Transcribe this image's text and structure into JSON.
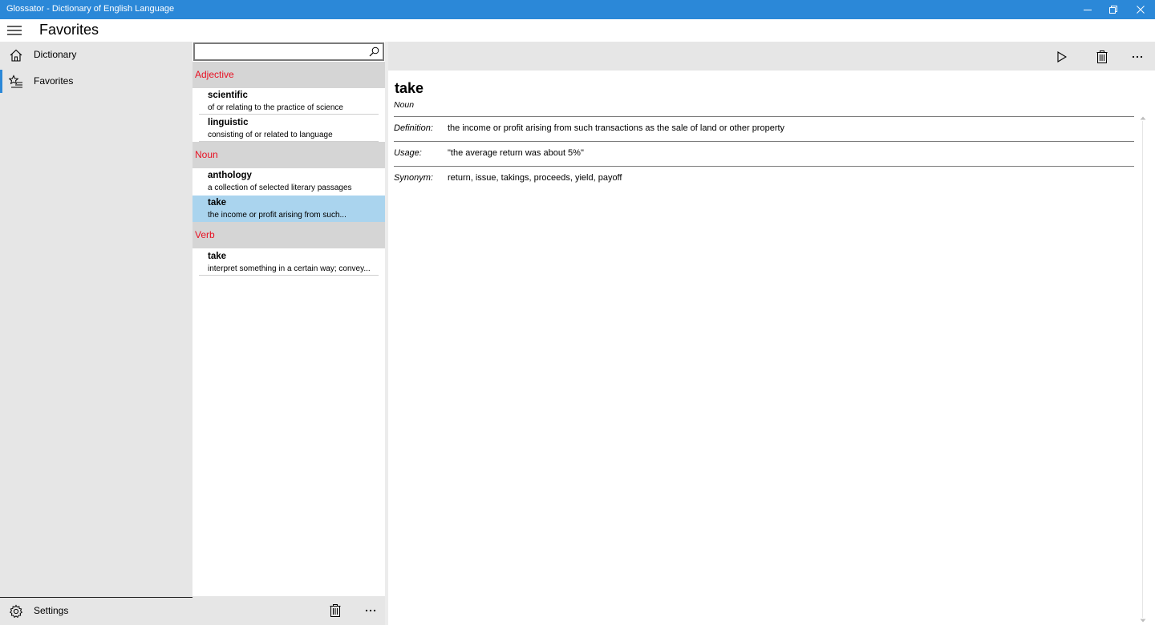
{
  "window": {
    "title": "Glossator - Dictionary of English Language"
  },
  "header": {
    "page_title": "Favorites"
  },
  "nav": {
    "items": [
      {
        "label": "Dictionary",
        "icon": "home-icon"
      },
      {
        "label": "Favorites",
        "icon": "favorites-icon",
        "selected": true
      }
    ],
    "settings_label": "Settings"
  },
  "search": {
    "value": "",
    "placeholder": ""
  },
  "list": {
    "groups": [
      {
        "header": "Adjective",
        "items": [
          {
            "word": "scientific",
            "gloss": "of or relating to the practice of science"
          },
          {
            "word": "linguistic",
            "gloss": "consisting of or related to language"
          }
        ]
      },
      {
        "header": "Noun",
        "items": [
          {
            "word": "anthology",
            "gloss": "a collection of selected literary passages"
          },
          {
            "word": "take",
            "gloss": "the income or profit arising from such...",
            "selected": true
          }
        ]
      },
      {
        "header": "Verb",
        "items": [
          {
            "word": "take",
            "gloss": "interpret something in a certain way; convey..."
          }
        ]
      }
    ]
  },
  "detail": {
    "headword": "take",
    "part_of_speech": "Noun",
    "rows": [
      {
        "key": "Definition:",
        "value": "the income or profit arising from such transactions as the sale of land or other property"
      },
      {
        "key": "Usage:",
        "value": "\"the average return was about 5%\""
      },
      {
        "key": "Synonym:",
        "value": "return, issue, takings, proceeds, yield, payoff"
      }
    ]
  },
  "colors": {
    "accent": "#2b88d8",
    "group_header_text": "#e81123",
    "selected_item": "#aad4ee"
  }
}
